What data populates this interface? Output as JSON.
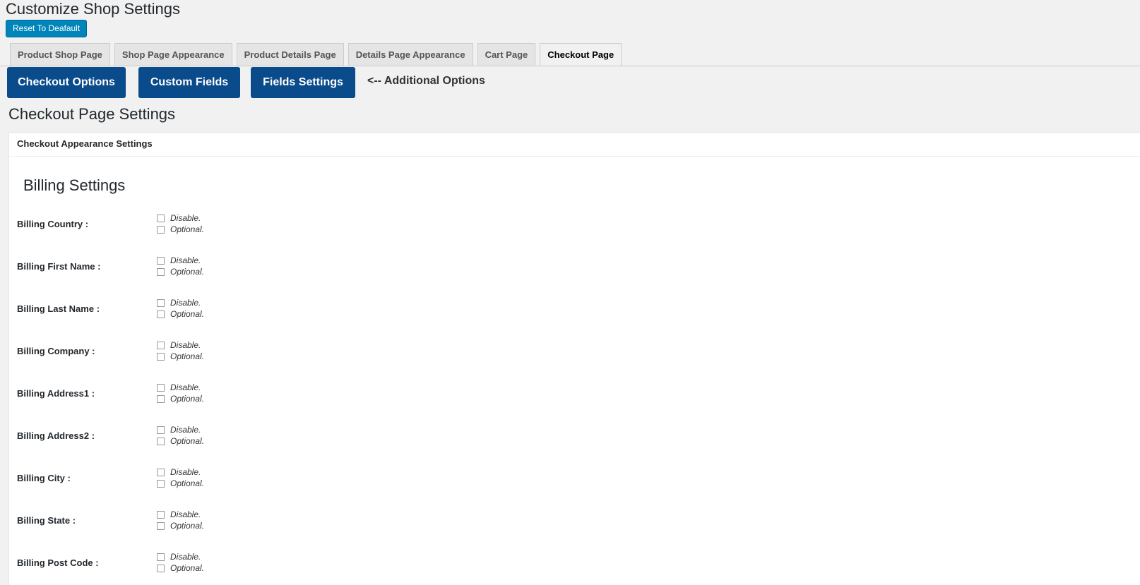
{
  "page": {
    "title": "Customize Shop Settings",
    "reset_label": "Reset To Deafault"
  },
  "tabs": [
    {
      "label": "Product Shop Page"
    },
    {
      "label": "Shop Page Appearance"
    },
    {
      "label": "Product Details Page"
    },
    {
      "label": "Details Page Appearance"
    },
    {
      "label": "Cart Page"
    },
    {
      "label": "Checkout Page",
      "active": true
    }
  ],
  "options_bar": {
    "checkout_options": "Checkout Options",
    "custom_fields": "Custom Fields",
    "fields_settings": "Fields Settings",
    "additional_label": "<-- Additional Options"
  },
  "section": {
    "title": "Checkout Page Settings",
    "panel_header": "Checkout Appearance Settings",
    "billing_title": "Billing Settings"
  },
  "option_labels": {
    "disable": "Disable.",
    "optional": "Optional."
  },
  "billing_fields": [
    {
      "label": "Billing Country :",
      "disable": false,
      "optional": false
    },
    {
      "label": "Billing First Name :",
      "disable": false,
      "optional": false
    },
    {
      "label": "Billing Last Name :",
      "disable": false,
      "optional": false
    },
    {
      "label": "Billing Company :",
      "disable": false,
      "optional": false
    },
    {
      "label": "Billing Address1 :",
      "disable": false,
      "optional": false
    },
    {
      "label": "Billing Address2 :",
      "disable": false,
      "optional": false
    },
    {
      "label": "Billing City :",
      "disable": false,
      "optional": false
    },
    {
      "label": "Billing State :",
      "disable": false,
      "optional": false
    },
    {
      "label": "Billing Post Code :",
      "disable": false,
      "optional": false
    }
  ]
}
